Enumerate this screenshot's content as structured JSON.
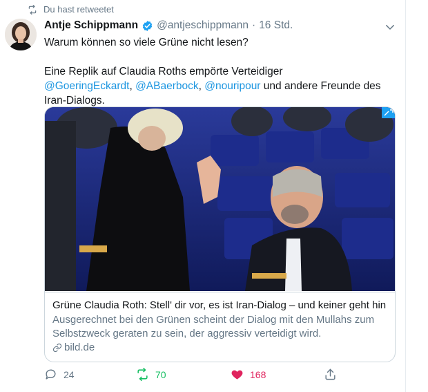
{
  "retweet_context": {
    "icon": "retweet-icon",
    "label": "Du hast retweetet"
  },
  "author": {
    "name": "Antje Schippmann",
    "verified_icon": "verified-badge-icon",
    "handle": "@antjeschippmann",
    "separator": "·",
    "time": "16 Std."
  },
  "tweet": {
    "line1": "Warum können so viele Grüne nicht lesen?",
    "line2_prefix": "Eine Replik auf Claudia Roths empörte Verteidiger",
    "mention1": "@GoeringEckardt",
    "comma1": ", ",
    "mention2": "@ABaerbock",
    "comma2": ", ",
    "mention3": "@nouripour",
    "suffix": " und andere Freunde des Iran-Dialogs."
  },
  "card": {
    "title": "Grüne Claudia Roth: Stell' dir vor, es ist Iran-Dialog – und keiner geht hin",
    "description": "Ausgerechnet bei den Grünen scheint der Dialog mit den Mullahs zum Selbstzweck geraten zu sein, der aggressiv verteidigt wird.",
    "domain": "bild.de",
    "link_icon": "link-icon"
  },
  "actions": {
    "reply_count": "24",
    "retweet_count": "70",
    "like_count": "168"
  },
  "colors": {
    "link": "#1b95e0",
    "secondary": "#657786",
    "retweet_active": "#17bf63",
    "like_active": "#e0245e",
    "verified": "#1da1f2"
  }
}
